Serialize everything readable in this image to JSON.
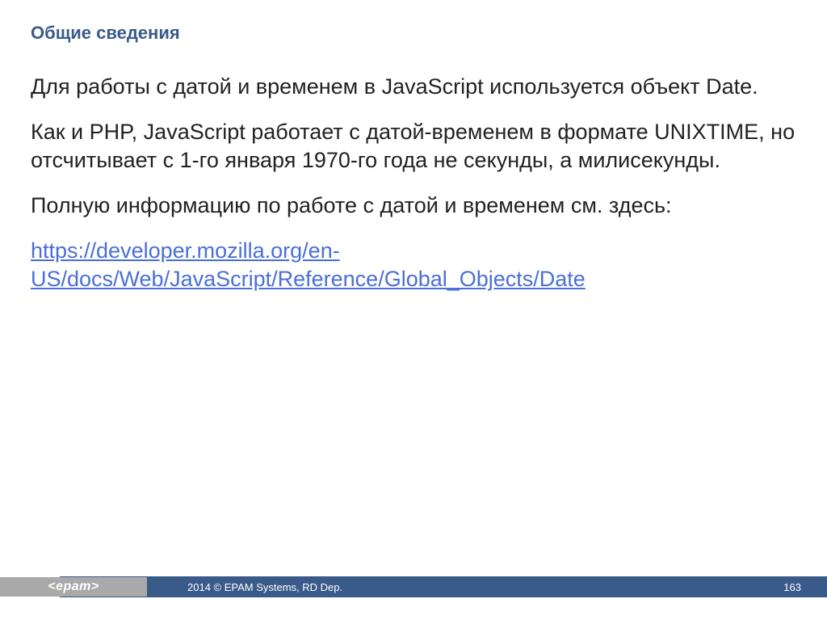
{
  "title": "Общие сведения",
  "paragraphs": {
    "p1": "Для работы с датой и временем в JavaScript используется объект Date.",
    "p2": "Как и PHP, JavaScript работает с датой-временем в формате UNIXTIME, но отсчитывает с 1-го января 1970-го года не секунды, а милисекунды.",
    "p3": "Полную информацию по работе с датой и временем см. здесь:",
    "link_text": "https://developer.mozilla.org/en-US/docs/Web/JavaScript/Reference/Global_Objects/Date"
  },
  "footer": {
    "logo": "<epam>",
    "copyright": "2014 © EPAM Systems, RD Dep.",
    "page": "163"
  }
}
